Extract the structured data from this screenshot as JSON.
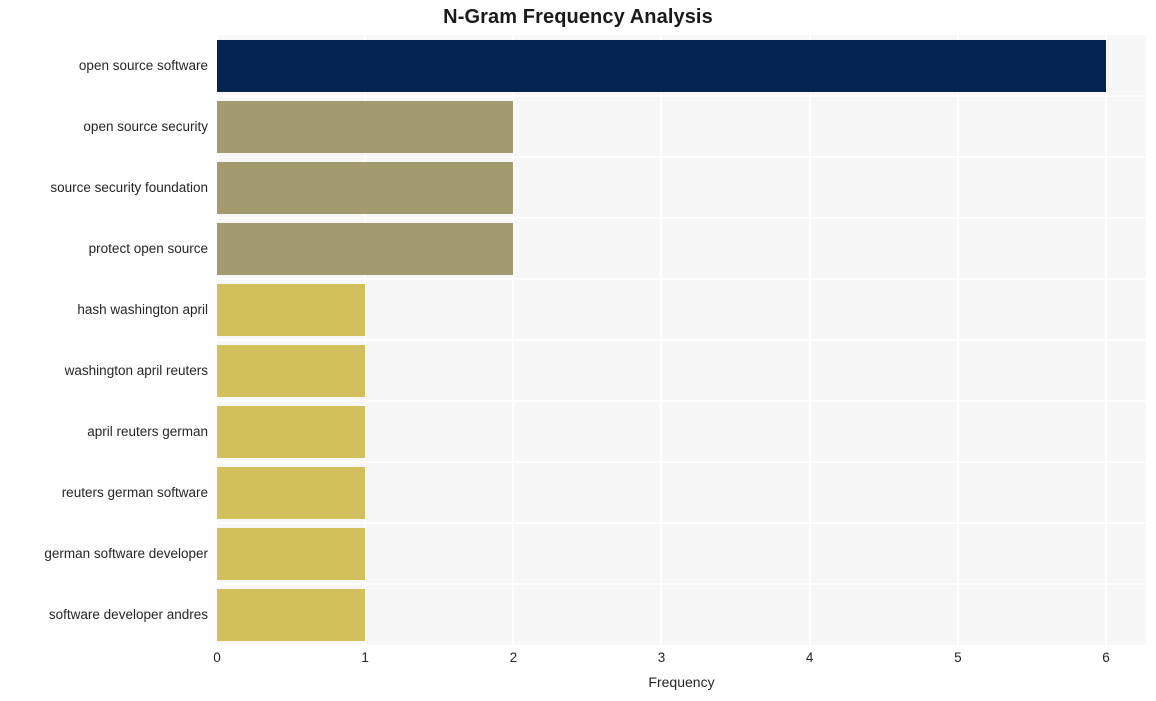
{
  "chart_data": {
    "type": "bar",
    "orientation": "horizontal",
    "title": "N-Gram Frequency Analysis",
    "xlabel": "Frequency",
    "ylabel": "",
    "categories": [
      "open source software",
      "open source security",
      "source security foundation",
      "protect open source",
      "hash washington april",
      "washington april reuters",
      "april reuters german",
      "reuters german software",
      "german software developer",
      "software developer andres"
    ],
    "values": [
      6,
      2,
      2,
      2,
      1,
      1,
      1,
      1,
      1,
      1
    ],
    "bar_colors": [
      "#042351",
      "#a39a70",
      "#a39a70",
      "#a39a70",
      "#d2c05c",
      "#d2c05c",
      "#d2c05c",
      "#d2c05c",
      "#d2c05c",
      "#d2c05c"
    ],
    "xlim": [
      0,
      6.27
    ],
    "xticks": [
      0,
      1,
      2,
      3,
      4,
      5,
      6
    ],
    "xtick_labels": [
      "0",
      "1",
      "2",
      "3",
      "4",
      "5",
      "6"
    ],
    "grid": true,
    "grid_color": "#ffffff",
    "plot_background": "#f7f7f7",
    "figure_background": "#ffffff",
    "legend": null,
    "legend_position": "none"
  }
}
